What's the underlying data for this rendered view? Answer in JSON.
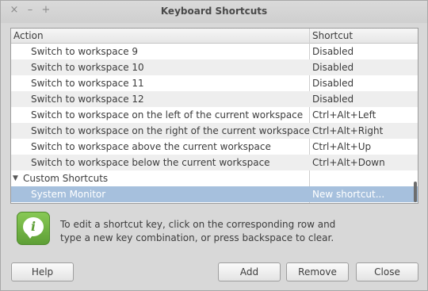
{
  "window": {
    "title": "Keyboard Shortcuts",
    "close_glyph": "×",
    "minimize_glyph": "–",
    "maximize_glyph": "+"
  },
  "table": {
    "columns": {
      "action": "Action",
      "shortcut": "Shortcut"
    },
    "rows": [
      {
        "action": "Switch to workspace 9",
        "shortcut": "Disabled"
      },
      {
        "action": "Switch to workspace 10",
        "shortcut": "Disabled"
      },
      {
        "action": "Switch to workspace 11",
        "shortcut": "Disabled"
      },
      {
        "action": "Switch to workspace 12",
        "shortcut": "Disabled"
      },
      {
        "action": "Switch to workspace on the left of the current workspace",
        "shortcut": "Ctrl+Alt+Left"
      },
      {
        "action": "Switch to workspace on the right of the current workspace",
        "shortcut": "Ctrl+Alt+Right"
      },
      {
        "action": "Switch to workspace above the current workspace",
        "shortcut": "Ctrl+Alt+Up"
      },
      {
        "action": "Switch to workspace below the current workspace",
        "shortcut": "Ctrl+Alt+Down"
      }
    ],
    "group": {
      "label": "Custom Shortcuts",
      "arrow": "▼"
    },
    "selected_row": {
      "action": "System Monitor",
      "shortcut": "New shortcut..."
    }
  },
  "info": {
    "icon": "info-icon",
    "glyph": "i",
    "message_line1": "To edit a shortcut key, click on the corresponding row and",
    "message_line2": "type a new key combination, or press backspace to clear."
  },
  "buttons": {
    "help": "Help",
    "add": "Add",
    "remove": "Remove",
    "close": "Close"
  },
  "colors": {
    "selection": "#a6c0dd",
    "info_green": "#6fb443"
  }
}
